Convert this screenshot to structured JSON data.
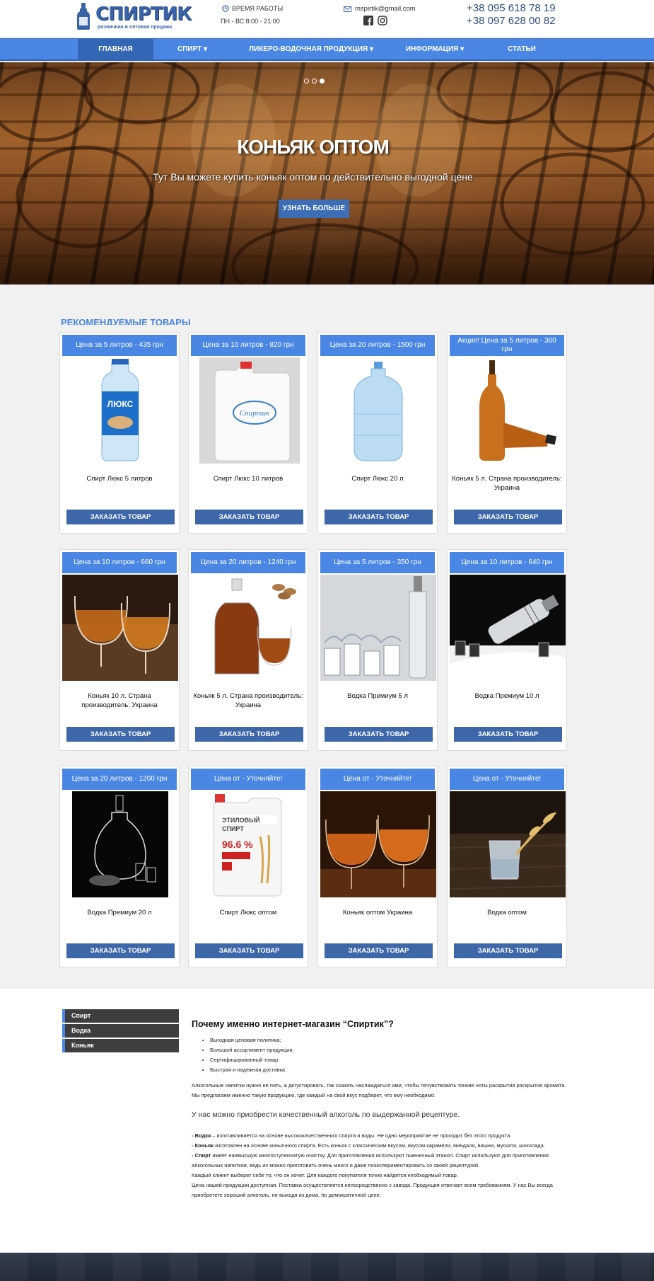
{
  "header": {
    "logo_text": "СПИРТИК",
    "logo_sub": "розничная и оптовая продажа",
    "hours_label": "ВРЕМЯ РАБОТЫ",
    "hours_value": "ПН - ВС 8:00 - 21:00",
    "email": "mspirtik@gmail.com",
    "phone1": "+38 095 618 78 19",
    "phone2": "+38 097 628 00 82",
    "icons": [
      "clock-icon",
      "mail-icon",
      "facebook-icon",
      "instagram-icon"
    ]
  },
  "nav": {
    "items": [
      {
        "label": "ГЛАВНАЯ",
        "active": true
      },
      {
        "label": "СПИРТ ▾",
        "active": false
      },
      {
        "label": "ЛИКЕРО-ВОДОЧНАЯ ПРОДУКЦИЯ ▾",
        "active": false
      },
      {
        "label": "ИНФОРМАЦИЯ ▾",
        "active": false
      },
      {
        "label": "СТАТЬИ",
        "active": false
      }
    ]
  },
  "hero": {
    "title": "КОНЬЯК ОПТОМ",
    "text": "Тут Вы можете купить коньяк оптом по действительно выгодной цене",
    "button": "УЗНАТЬ БОЛЬШЕ",
    "slides": 3,
    "active_slide": 3
  },
  "recommended": {
    "title": "РЕКОМЕНДУЕМЫЕ ТОВАРЫ",
    "button_label": "ЗАКАЗАТЬ ТОВАР",
    "products": [
      {
        "price": "Цена за 5 литров - 435 грн",
        "name": "Спирт Люкс 5 литров",
        "image": "water-bottle-5l"
      },
      {
        "price": "Цена за 10 литров - 820 грн",
        "name": "Спирт Люкс 10 литров",
        "image": "canister-10l"
      },
      {
        "price": "Цена за 20 литров - 1500 грн",
        "name": "Спирт Люкс 20 л",
        "image": "water-jug-20l"
      },
      {
        "price": "Акция! Цена за 5 литров - 360 грн",
        "name": "Коньяк 5 л. Страна производитель: Украина",
        "image": "cognac-bottles"
      },
      {
        "price": "Цена за 10 литров - 660 грн",
        "name": "Коньяк 10 л. Страна производитель: Украина",
        "image": "cognac-glasses"
      },
      {
        "price": "Цена за 20 литров - 1240 грн",
        "name": "Коньяк 5 л. Страна производитель: Украина",
        "image": "cognac-decanter"
      },
      {
        "price": "Цена за 5 литров - 350 грн",
        "name": "Водка Премиум 5 л",
        "image": "vodka-splash"
      },
      {
        "price": "Цена за 10 литров - 640 грн",
        "name": "Водка Премиум 10 л",
        "image": "vodka-ice"
      },
      {
        "price": "Цена за 20 литров - 1200 грн",
        "name": "Водка Премиум 20 л",
        "image": "vodka-decanter-black"
      },
      {
        "price": "Цена от - Уточняйте!",
        "name": "Спирт Люкс оптом",
        "image": "ethyl-canister"
      },
      {
        "price": "Цена от - Уточняйте!",
        "name": "Коньяк оптом Украина",
        "image": "cognac-glasses-dark"
      },
      {
        "price": "Цена от - Уточняйте!",
        "name": "Водка оптом",
        "image": "vodka-glass-wheat"
      }
    ]
  },
  "sidebar": {
    "items": [
      "Спирт",
      "Водка",
      "Коньяк"
    ]
  },
  "article": {
    "title": "Почему именно интернет-магазин “Спиртик”?",
    "bullets": [
      "Выгодная ценовая политика;",
      "Большой ассортимент продукции;",
      "Сертифицированный товар;",
      "Быстрая и надежная доставка."
    ],
    "p1": "Алкогольные напитки нужно не пить, а дегустировать, так сказать наслаждаться ими, чтобы почувствовать тонкие ноты раскрытия раскрытия аромата. Мы предлагаем именно такую продукцию, где каждый на свой вкус подберет, что ему необходимо.",
    "p_big": "У нас можно приобрести качественный алкоголь по выдержанной рецептуре.",
    "vodka_label": "- Водка",
    "vodka_text": " – изготавливается на основе высококачественного спирта и воды. Не одно мероприятие не проходит без этого продукта.",
    "cognac_label": "- Коньяк",
    "cognac_text": " изготовлен на основе коньячного спирта. Есть коньяк с классическим вкусом, вкусом карамели, миндаля, вишни, муската, шоколада.",
    "spirit_label": "- Спирт",
    "spirit_text": " имеет наивысшую многоступенчатую очистку. Для приготовления используют пшеничный этанол. Спирт используют для приготовления алкогольных напитков, ведь их можно приготовить очень много и даже поэкспериментировать со своей рецептурой.",
    "p_client": "Каждый клиент выберет себе то, что он хочет. Для каждого покупателя точно найдется необходимый товар.",
    "p_price": "Цена нашей продукции доступная. Поставка осуществляется непосредственно с завода. Продукция отвечает всем требованиям. У нас Вы всегда приобретете хороший алкоголь, не выходя из дома, по демократичной цене."
  },
  "colors": {
    "accent": "#4a86e4",
    "button": "#3d67a8",
    "sidebar": "#3e3e3e",
    "footer": "#2c3645"
  }
}
